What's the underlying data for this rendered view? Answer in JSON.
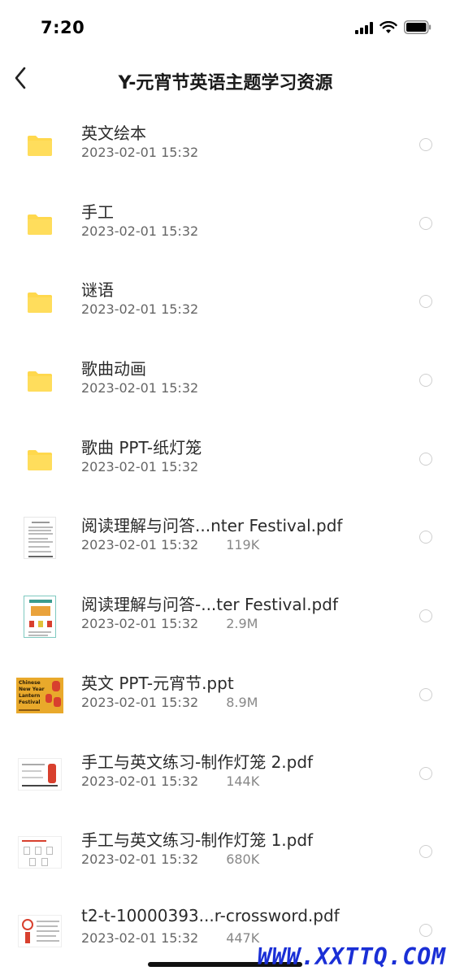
{
  "status_bar": {
    "time": "7:20"
  },
  "nav": {
    "title": "Y-元宵节英语主题学习资源"
  },
  "files": [
    {
      "name": "英文绘本",
      "date": "2023-02-01 15:32",
      "size": "",
      "type": "folder"
    },
    {
      "name": "手工",
      "date": "2023-02-01 15:32",
      "size": "",
      "type": "folder"
    },
    {
      "name": "谜语",
      "date": "2023-02-01 15:32",
      "size": "",
      "type": "folder"
    },
    {
      "name": "歌曲动画",
      "date": "2023-02-01 15:32",
      "size": "",
      "type": "folder"
    },
    {
      "name": "歌曲 PPT-纸灯笼",
      "date": "2023-02-01 15:32",
      "size": "",
      "type": "folder"
    },
    {
      "name": "阅读理解与问答...nter Festival.pdf",
      "date": "2023-02-01 15:32",
      "size": "119K",
      "type": "pdf"
    },
    {
      "name": "阅读理解与问答-...ter Festival.pdf",
      "date": "2023-02-01 15:32",
      "size": "2.9M",
      "type": "pdf"
    },
    {
      "name": "英文 PPT-元宵节.ppt",
      "date": "2023-02-01 15:32",
      "size": "8.9M",
      "type": "ppt"
    },
    {
      "name": "手工与英文练习-制作灯笼 2.pdf",
      "date": "2023-02-01 15:32",
      "size": "144K",
      "type": "pdf"
    },
    {
      "name": "手工与英文练习-制作灯笼 1.pdf",
      "date": "2023-02-01 15:32",
      "size": "680K",
      "type": "pdf"
    },
    {
      "name": "t2-t-10000393...r-crossword.pdf",
      "date": "2023-02-01 15:32",
      "size": "447K",
      "type": "pdf"
    }
  ],
  "thumbnail_text": {
    "ppt": "Chinese New Year Lantern Festival"
  },
  "watermark": "WWW.XXTTQ.COM",
  "colors": {
    "folder": "#FFD84D",
    "ppt_bg": "#E9A92B",
    "ppt_red": "#D8402E",
    "radio_border": "#CFCFCF",
    "watermark": "#1A2FD6"
  }
}
